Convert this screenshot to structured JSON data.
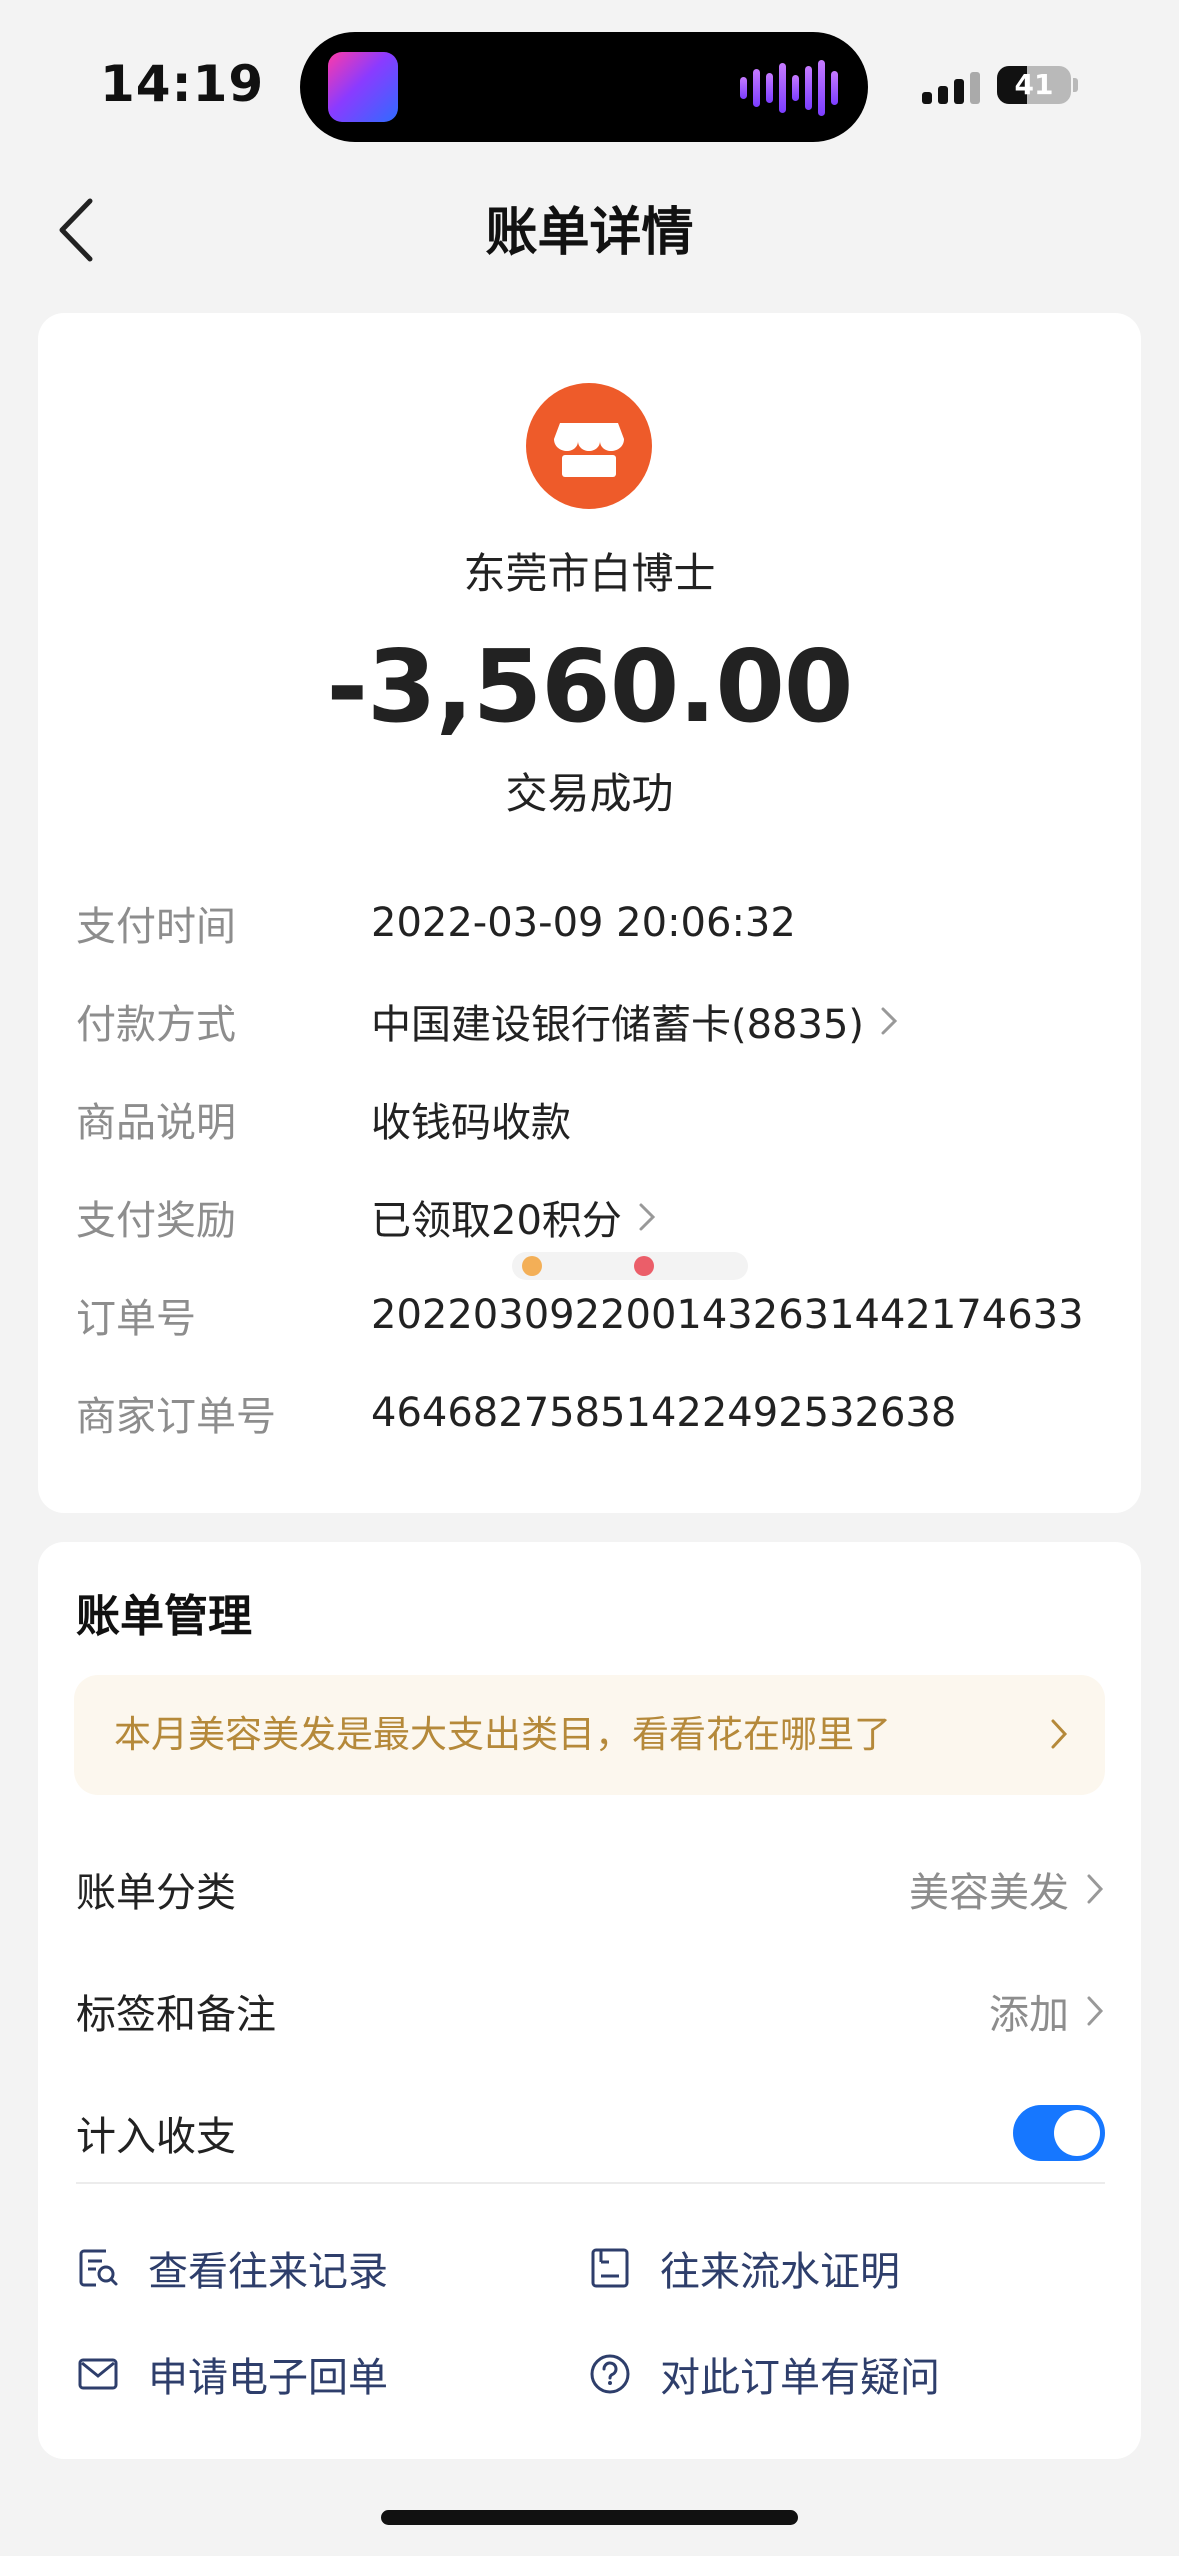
{
  "status_bar": {
    "time": "14:19",
    "battery": "41",
    "battery_level_percent": 41
  },
  "nav": {
    "title": "账单详情",
    "back_icon": "chevron-left-icon"
  },
  "transaction": {
    "merchant_icon": "storefront-icon",
    "merchant_name": "东莞市白博士",
    "amount": "-3,560.00",
    "status": "交易成功",
    "details": [
      {
        "label": "支付时间",
        "value": "2022-03-09 20:06:32",
        "has_chevron": false
      },
      {
        "label": "付款方式",
        "value": "中国建设银行储蓄卡(8835)",
        "has_chevron": true
      },
      {
        "label": "商品说明",
        "value": "收钱码收款",
        "has_chevron": false
      },
      {
        "label": "支付奖励",
        "value": "已领取20积分",
        "has_chevron": true
      },
      {
        "label": "订单号",
        "value": "2022030922001432631442174633",
        "has_chevron": false
      },
      {
        "label": "商家订单号",
        "value": "4646827585142249253263​8",
        "has_chevron": false
      }
    ]
  },
  "management": {
    "title": "账单管理",
    "promo": "本月美容美发是最大支出类目，看看花在哪里了",
    "category": {
      "label": "账单分类",
      "value": "美容美发"
    },
    "tags": {
      "label": "标签和备注",
      "value": "添加"
    },
    "include": {
      "label": "计入收支",
      "enabled": true
    },
    "actions": [
      {
        "label": "查看往来记录",
        "icon": "search-record-icon"
      },
      {
        "label": "往来流水证明",
        "icon": "document-icon"
      },
      {
        "label": "申请电子回单",
        "icon": "mail-icon"
      },
      {
        "label": "对此订单有疑问",
        "icon": "question-icon"
      }
    ]
  },
  "colors": {
    "accent": "#1677ff",
    "merchant_icon_bg": "#ee5b2a",
    "promo_text": "#b5893a",
    "action_text": "#2e3e6b"
  }
}
